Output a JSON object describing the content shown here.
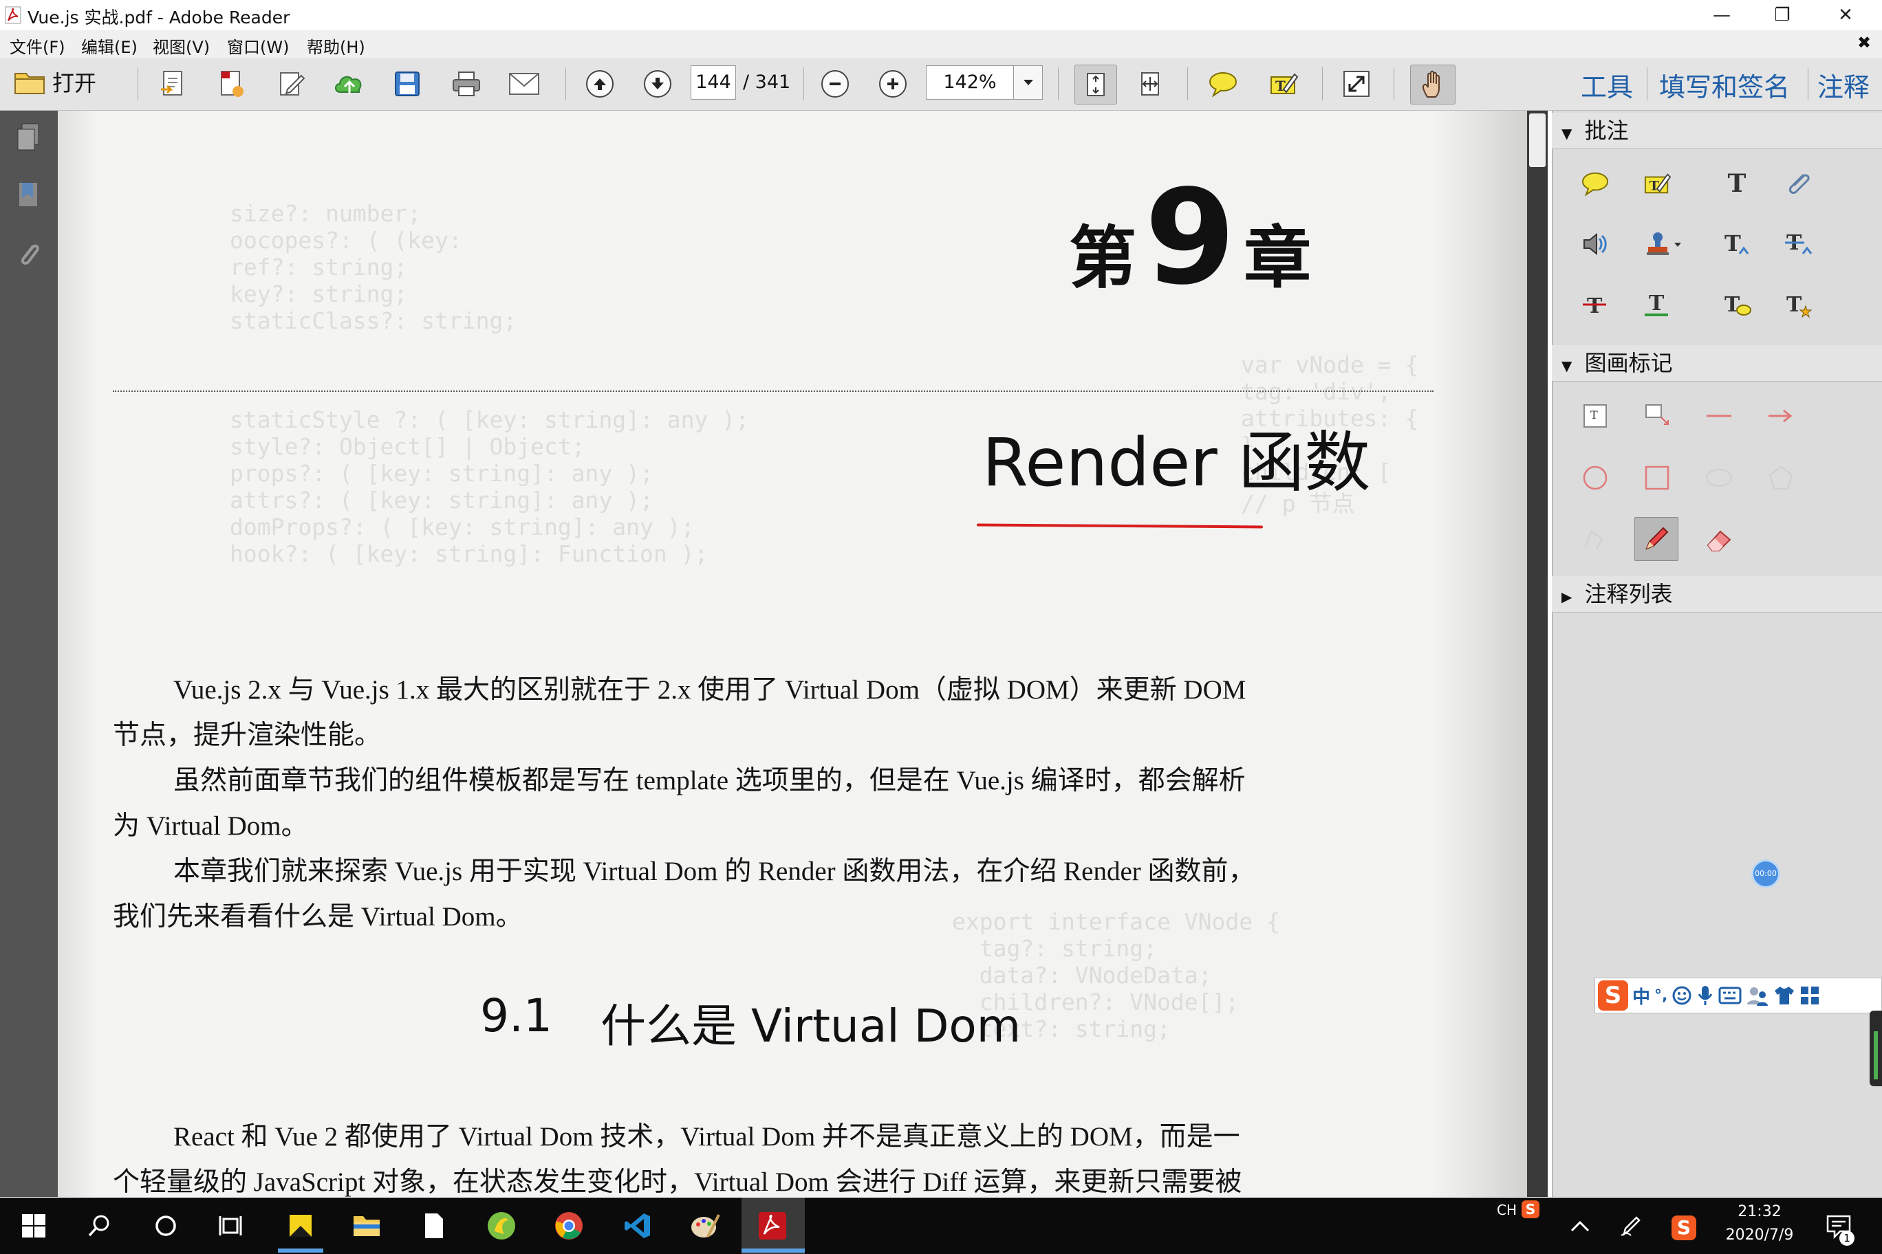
{
  "window": {
    "title": "Vue.js 实战.pdf - Adobe Reader",
    "minimize": "—",
    "restore": "❐",
    "close": "✕",
    "doc_close": "✖"
  },
  "menu": [
    "文件(F)",
    "编辑(E)",
    "视图(V)",
    "窗口(W)",
    "帮助(H)"
  ],
  "toolbar": {
    "open_label": "打开",
    "current_page": "144",
    "total_pages": "/ 341",
    "zoom": "142%",
    "tools_label": "工具",
    "fill_sign_label": "填写和签名",
    "comment_label": "注释"
  },
  "document": {
    "chapter_prefix": "第",
    "chapter_number": "9",
    "chapter_suffix": "章",
    "chapter_title": "Render 函数",
    "paragraphs": [
      {
        "l1": "Vue.js 2.x 与 Vue.js 1.x 最大的区别就在于 2.x 使用了 Virtual Dom（虚拟 DOM）来更新 DOM",
        "l2": "节点，提升渲染性能。"
      },
      {
        "l1": "虽然前面章节我们的组件模板都是写在 template 选项里的，但是在 Vue.js 编译时，都会解析",
        "l2": "为 Virtual Dom。"
      },
      {
        "l1": "本章我们就来探索 Vue.js 用于实现 Virtual Dom 的 Render 函数用法，在介绍 Render 函数前，",
        "l2": "我们先来看看什么是 Virtual Dom。"
      }
    ],
    "section_number": "9.1",
    "section_title": "什么是 Virtual Dom",
    "paragraph4": {
      "l1": "React 和 Vue 2 都使用了 Virtual Dom 技术，Virtual Dom 并不是真正意义上的 DOM，而是一",
      "l2": "个轻量级的 JavaScript 对象，在状态发生变化时，Virtual Dom 会进行 Diff 运算，来更新只需要被"
    }
  },
  "panel": {
    "annotations_header": "批注",
    "drawing_header": "图画标记",
    "comment_list_header": "注释列表",
    "timer_badge": "00:00"
  },
  "ime": {
    "mode": "中",
    "punct": "°,"
  },
  "taskbar": {
    "lang": "CH",
    "time": "21:32",
    "date": "2020/7/9",
    "notif_count": "1"
  },
  "colors": {
    "link_blue": "#1f5fa8",
    "underline_red": "#d81e1e",
    "acrobat_red": "#c4161c",
    "sogou_orange": "#f25a22"
  }
}
